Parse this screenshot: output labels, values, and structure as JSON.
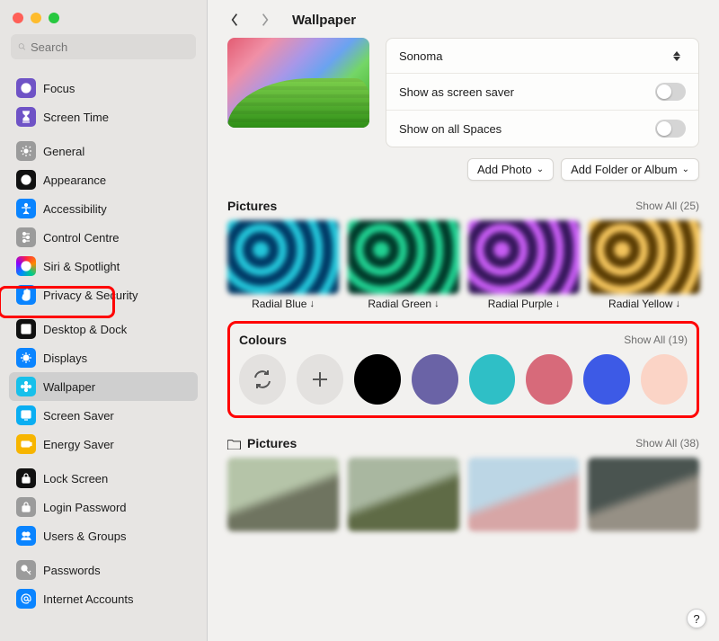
{
  "search": {
    "placeholder": "Search"
  },
  "sidebar": {
    "groups": [
      [
        {
          "label": "Focus",
          "icon": "moon",
          "bg": "#6f53c6"
        },
        {
          "label": "Screen Time",
          "icon": "hourglass",
          "bg": "#6f53c6"
        }
      ],
      [
        {
          "label": "General",
          "icon": "gear",
          "bg": "#9b9b9b"
        },
        {
          "label": "Appearance",
          "icon": "appear",
          "bg": "#111111"
        },
        {
          "label": "Accessibility",
          "icon": "access",
          "bg": "#0a84ff"
        },
        {
          "label": "Control Centre",
          "icon": "sliders",
          "bg": "#9b9b9b"
        },
        {
          "label": "Siri & Spotlight",
          "icon": "siri",
          "bg": "grad"
        },
        {
          "label": "Privacy & Security",
          "icon": "hand",
          "bg": "#0a84ff"
        }
      ],
      [
        {
          "label": "Desktop & Dock",
          "icon": "dock",
          "bg": "#111111"
        },
        {
          "label": "Displays",
          "icon": "sun",
          "bg": "#0a84ff"
        },
        {
          "label": "Wallpaper",
          "icon": "flower",
          "bg": "#17c0eb",
          "selected": true
        },
        {
          "label": "Screen Saver",
          "icon": "ssaver",
          "bg": "#0aaef2"
        },
        {
          "label": "Energy Saver",
          "icon": "battery",
          "bg": "#f7b500"
        }
      ],
      [
        {
          "label": "Lock Screen",
          "icon": "padlock",
          "bg": "#111111"
        },
        {
          "label": "Login Password",
          "icon": "lock",
          "bg": "#9b9b9b"
        },
        {
          "label": "Users & Groups",
          "icon": "users",
          "bg": "#0a84ff"
        }
      ],
      [
        {
          "label": "Passwords",
          "icon": "key",
          "bg": "#9b9b9b"
        },
        {
          "label": "Internet Accounts",
          "icon": "at",
          "bg": "#0a84ff"
        }
      ]
    ]
  },
  "header": {
    "title": "Wallpaper"
  },
  "wallpaper": {
    "name": "Sonoma",
    "toggles": [
      {
        "label": "Show as screen saver",
        "on": false
      },
      {
        "label": "Show on all Spaces",
        "on": false
      }
    ],
    "buttons": {
      "add_photo": "Add Photo",
      "add_folder": "Add Folder or Album"
    }
  },
  "sections": {
    "pictures1": {
      "title": "Pictures",
      "showall": "Show All",
      "count": "(25)",
      "items": [
        {
          "label": "Radial Blue",
          "c1": "#003a66",
          "c2": "#23c5d9"
        },
        {
          "label": "Radial Green",
          "c1": "#003a2a",
          "c2": "#20d091"
        },
        {
          "label": "Radial Purple",
          "c1": "#35175a",
          "c2": "#c65cf2"
        },
        {
          "label": "Radial Yellow",
          "c1": "#5a3c03",
          "c2": "#f2c35c"
        }
      ]
    },
    "colours": {
      "title": "Colours",
      "showall": "Show All",
      "count": "(19)",
      "swatches": [
        "#000000",
        "#6a63a6",
        "#2fbfc6",
        "#d76a7a",
        "#3d5ae6",
        "#fbd4c6"
      ]
    },
    "pictures2": {
      "title": "Pictures",
      "showall": "Show All",
      "count": "(38)",
      "items": [
        {
          "c1": "#b5c4a8",
          "c2": "#6f7460"
        },
        {
          "c1": "#a9b7a0",
          "c2": "#5f6b46"
        },
        {
          "c1": "#bcd6e5",
          "c2": "#d7a6a6"
        },
        {
          "c1": "#4a5450",
          "c2": "#969085"
        }
      ]
    }
  },
  "help": "?"
}
